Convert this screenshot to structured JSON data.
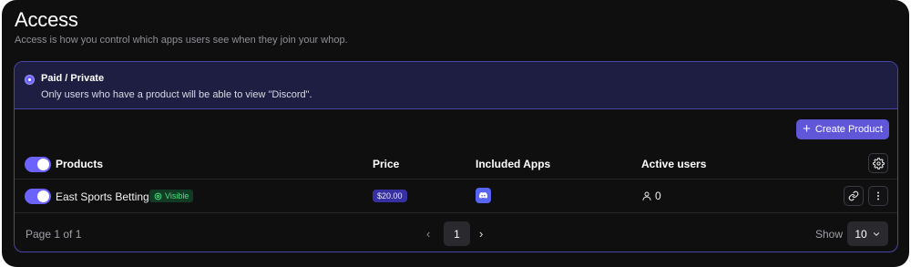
{
  "page": {
    "title": "Access",
    "subtitle": "Access is how you control which apps users see when they join your whop."
  },
  "access_option": {
    "title": "Paid / Private",
    "description": "Only users who have a product will be able to view \"Discord\"."
  },
  "toolbar": {
    "create_label": "Create Product"
  },
  "table": {
    "columns": [
      "Products",
      "Price",
      "Included Apps",
      "Active users"
    ],
    "rows": [
      {
        "name": "East Sports Betting",
        "badge": "Visible",
        "price": "$20.00",
        "app_icon": "discord-icon",
        "active_users": "0",
        "enabled": true
      }
    ]
  },
  "pagination": {
    "page_info": "Page 1 of 1",
    "current_page": "1",
    "show_label": "Show",
    "page_size": "10"
  },
  "colors": {
    "accent": "#6c63ff",
    "card_border": "#4a46a8",
    "visible_badge": "#4ade80",
    "discord": "#5865f2"
  }
}
